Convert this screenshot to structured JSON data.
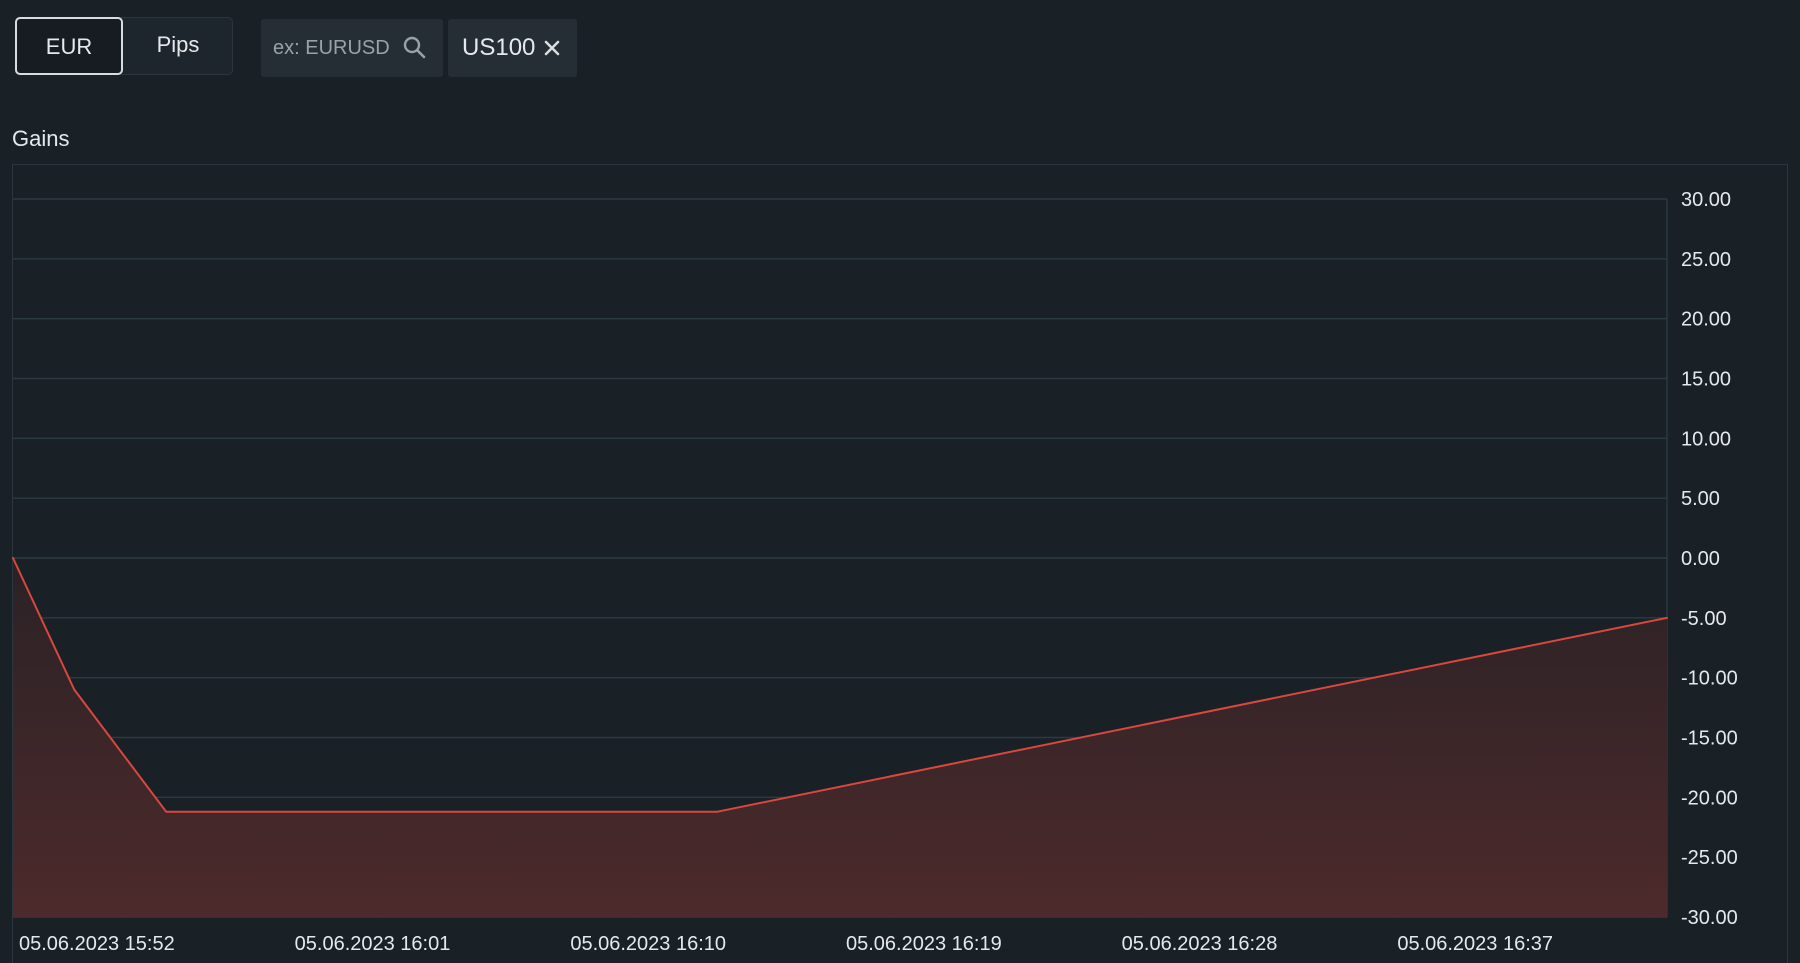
{
  "toolbar": {
    "unit_options": [
      "EUR",
      "Pips"
    ],
    "selected_unit": "EUR",
    "search_placeholder": "ex: EURUSD",
    "selected_symbol": "US100"
  },
  "chart_title": "Gains",
  "colors": {
    "background": "#192026",
    "grid": "#2c3a42",
    "line": "#d9473f",
    "fill_top": "#2a2226",
    "fill_bottom": "#4d2a2b"
  },
  "chart_data": {
    "type": "area",
    "title": "Gains",
    "xlabel": "",
    "ylabel": "",
    "x_tick_labels": [
      "05.06.2023 15:52",
      "05.06.2023 16:01",
      "05.06.2023 16:10",
      "05.06.2023 16:19",
      "05.06.2023 16:28",
      "05.06.2023 16:37"
    ],
    "y_tick_labels": [
      "30.00",
      "25.00",
      "20.00",
      "15.00",
      "10.00",
      "5.00",
      "0.00",
      "-5.00",
      "-10.00",
      "-15.00",
      "-20.00",
      "-25.00",
      "-30.00"
    ],
    "ylim": [
      -30,
      30
    ],
    "xlim": [
      "05.06.2023 15:52",
      "05.06.2023 16:46"
    ],
    "y_axis_position": "right",
    "grid": true,
    "legend": false,
    "series": [
      {
        "x": [
          "05.06.2023 15:52",
          "05.06.2023 15:54",
          "05.06.2023 15:57",
          "05.06.2023 16:15",
          "05.06.2023 16:46"
        ],
        "values": [
          0,
          -11,
          -21.2,
          -21.2,
          -5
        ]
      }
    ]
  }
}
